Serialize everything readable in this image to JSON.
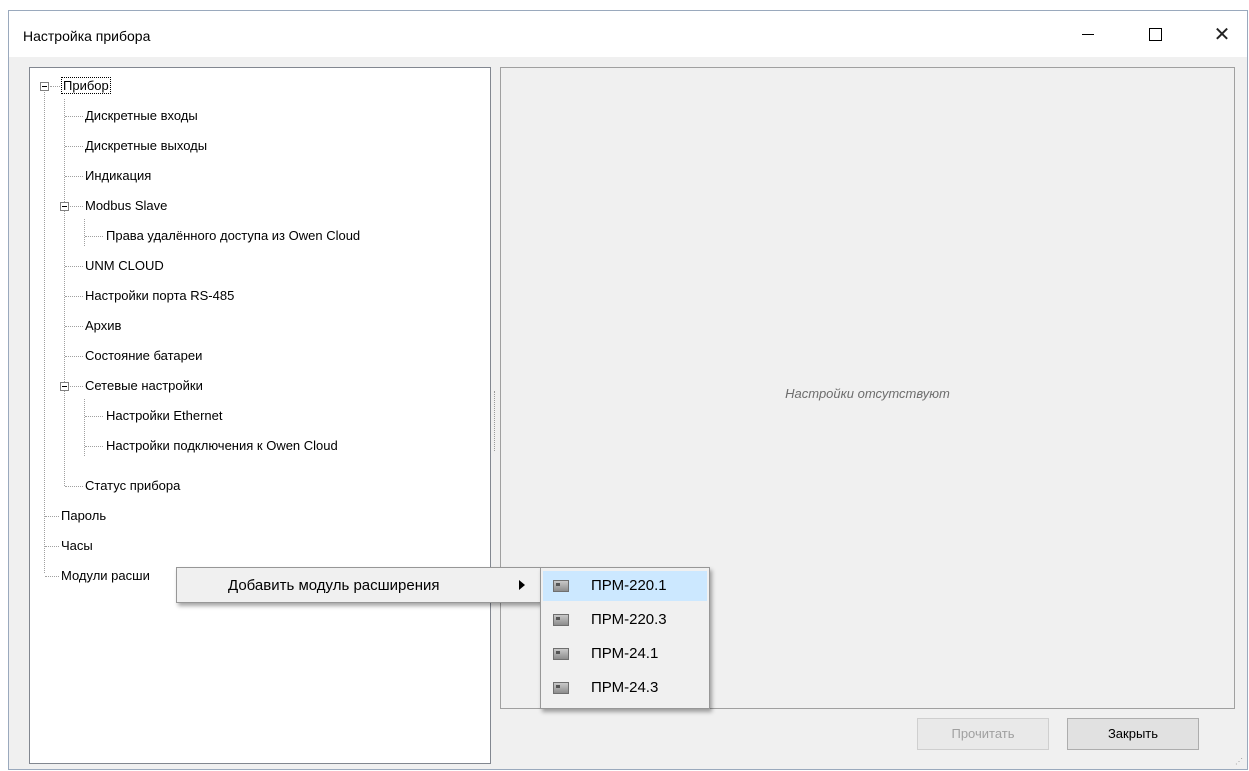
{
  "window": {
    "title": "Настройка прибора"
  },
  "tree": {
    "nodes": [
      {
        "label": "Прибор"
      },
      {
        "label": "Дискретные входы"
      },
      {
        "label": "Дискретные выходы"
      },
      {
        "label": "Индикация"
      },
      {
        "label": "Modbus Slave"
      },
      {
        "label": "Права удалённого доступа из Owen Cloud"
      },
      {
        "label": "UNM CLOUD"
      },
      {
        "label": "Настройки порта RS-485"
      },
      {
        "label": "Архив"
      },
      {
        "label": "Состояние батареи"
      },
      {
        "label": "Сетевые настройки"
      },
      {
        "label": "Настройки Ethernet"
      },
      {
        "label": "Настройки подключения к Owen Cloud"
      },
      {
        "label": "Статус прибора"
      },
      {
        "label": "Пароль"
      },
      {
        "label": "Часы"
      },
      {
        "label": "Модули расши"
      }
    ]
  },
  "panel": {
    "message": "Настройки отсутствуют"
  },
  "buttons": {
    "read": "Прочитать",
    "close": "Закрыть"
  },
  "context_menu": {
    "item": "Добавить модуль расширения",
    "submenu": [
      {
        "label": "ПРМ-220.1",
        "icon": "module-icon"
      },
      {
        "label": "ПРМ-220.3",
        "icon": "module-icon"
      },
      {
        "label": "ПРМ-24.1",
        "icon": "module-icon"
      },
      {
        "label": "ПРМ-24.3",
        "icon": "module-icon"
      }
    ]
  }
}
